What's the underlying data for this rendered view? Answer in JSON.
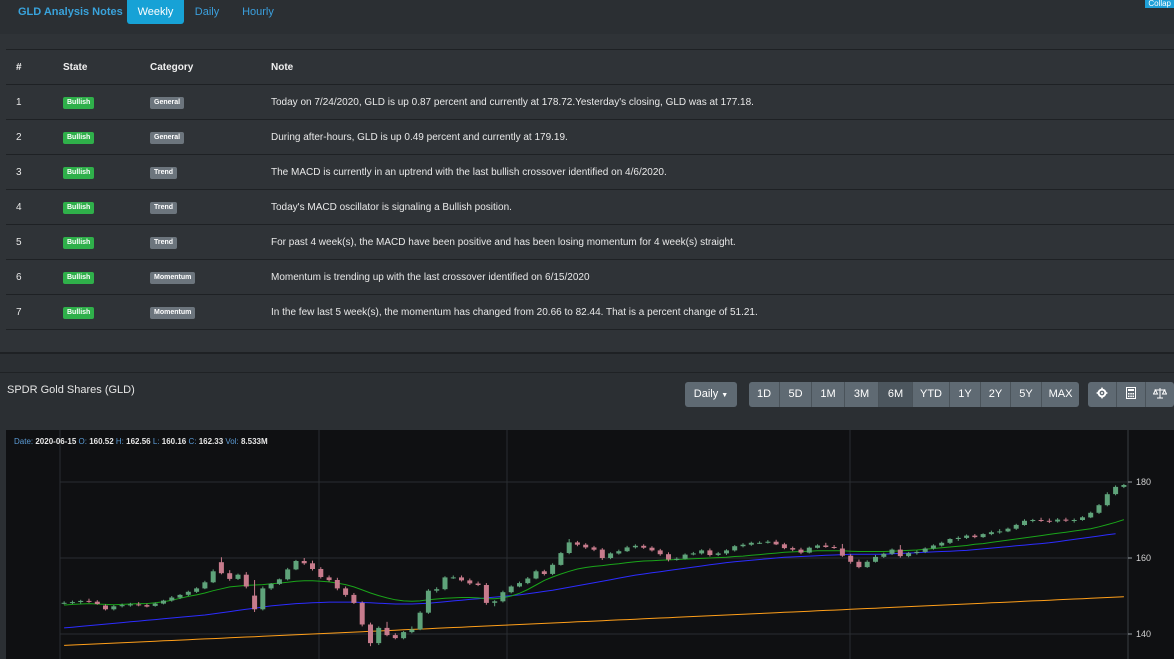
{
  "nav": {
    "brand": "GLD Analysis Notes",
    "tabs": [
      {
        "label": "Weekly",
        "active": true
      },
      {
        "label": "Daily",
        "active": false
      },
      {
        "label": "Hourly",
        "active": false
      }
    ],
    "collapse_label": "Collap"
  },
  "notes_table": {
    "headers": [
      "#",
      "State",
      "Category",
      "Note"
    ],
    "rows": [
      {
        "num": "1",
        "state": "Bullish",
        "category": "General",
        "note": "Today on 7/24/2020, GLD is up 0.87 percent and currently at 178.72.Yesterday's closing, GLD was at 177.18."
      },
      {
        "num": "2",
        "state": "Bullish",
        "category": "General",
        "note": "During after-hours, GLD is up 0.49 percent and currently at 179.19."
      },
      {
        "num": "3",
        "state": "Bullish",
        "category": "Trend",
        "note": "The MACD is currently in an uptrend with the last bullish crossover identified on 4/6/2020."
      },
      {
        "num": "4",
        "state": "Bullish",
        "category": "Trend",
        "note": "Today's MACD oscillator is signaling a Bullish position."
      },
      {
        "num": "5",
        "state": "Bullish",
        "category": "Trend",
        "note": "For past 4 week(s), the MACD have been positive and has been losing momentum for 4 week(s) straight."
      },
      {
        "num": "6",
        "state": "Bullish",
        "category": "Momentum",
        "note": "Momentum is trending up with the last crossover identified on 6/15/2020"
      },
      {
        "num": "7",
        "state": "Bullish",
        "category": "Momentum",
        "note": "In the few last 5 week(s), the momentum has changed from 20.66 to 82.44. That is a percent change of 51.21."
      }
    ]
  },
  "chart_header": {
    "title": "SPDR Gold Shares (GLD)",
    "interval_label": "Daily",
    "ranges": [
      "1D",
      "5D",
      "1M",
      "3M",
      "6M",
      "YTD",
      "1Y",
      "2Y",
      "5Y",
      "MAX"
    ],
    "active_range": "6M",
    "tool_icons": [
      "settings-icon",
      "calculator-icon",
      "balance-scale-icon"
    ]
  },
  "ohlc": {
    "date_label": "Date:",
    "date": "2020-06-15",
    "open_label": "O:",
    "open": "160.52",
    "high_label": "H:",
    "high": "162.56",
    "low_label": "L:",
    "low": "160.16",
    "close_label": "C:",
    "close": "162.33",
    "vol_label": "Vol:",
    "vol": "8.533M"
  },
  "colors": {
    "up": "#5fa37a",
    "down": "#c77b8c",
    "ma_short": "#1aa51a",
    "ma_mid": "#2c2cff",
    "ma_long": "#ff9f1a",
    "accent": "#17a2d6",
    "bullish": "#2fb04a"
  },
  "chart_data": {
    "type": "candlestick",
    "y_ticks": [
      "180",
      "160",
      "140"
    ],
    "ylim": [
      135,
      186
    ],
    "candles": [
      [
        148.1,
        148.6,
        147.8,
        148.2
      ],
      [
        148.2,
        148.8,
        147.9,
        148.4
      ],
      [
        148.4,
        149.0,
        148.0,
        148.7
      ],
      [
        148.7,
        149.3,
        148.2,
        148.5
      ],
      [
        148.5,
        148.9,
        147.7,
        147.9
      ],
      [
        147.5,
        147.8,
        146.2,
        146.5
      ],
      [
        146.5,
        147.6,
        146.2,
        147.3
      ],
      [
        147.3,
        148.0,
        147.0,
        147.6
      ],
      [
        147.6,
        148.2,
        147.2,
        147.8
      ],
      [
        147.8,
        148.4,
        147.3,
        147.6
      ],
      [
        147.6,
        148.0,
        147.0,
        147.2
      ],
      [
        147.4,
        148.3,
        147.2,
        148.0
      ],
      [
        148.0,
        149.0,
        147.8,
        148.8
      ],
      [
        148.8,
        150.0,
        148.5,
        149.6
      ],
      [
        149.6,
        150.5,
        149.2,
        150.3
      ],
      [
        150.3,
        151.4,
        150.0,
        151.1
      ],
      [
        151.1,
        152.3,
        150.8,
        152.0
      ],
      [
        152.0,
        154.0,
        151.8,
        153.6
      ],
      [
        153.6,
        157.0,
        153.4,
        156.5
      ],
      [
        158.9,
        160.2,
        155.7,
        156.0
      ],
      [
        156.0,
        156.8,
        154.0,
        154.5
      ],
      [
        154.5,
        155.9,
        154.2,
        155.6
      ],
      [
        155.6,
        156.3,
        152.0,
        152.5
      ],
      [
        150.1,
        154.2,
        145.8,
        146.5
      ],
      [
        146.5,
        152.5,
        146.2,
        152.0
      ],
      [
        152.0,
        153.4,
        151.6,
        153.2
      ],
      [
        153.2,
        154.6,
        152.9,
        154.4
      ],
      [
        154.4,
        157.4,
        154.1,
        157.0
      ],
      [
        157.0,
        159.5,
        156.8,
        159.2
      ],
      [
        159.2,
        160.0,
        158.2,
        158.6
      ],
      [
        158.6,
        159.3,
        156.7,
        157.1
      ],
      [
        157.1,
        157.6,
        154.6,
        155.0
      ],
      [
        154.9,
        155.4,
        153.8,
        154.2
      ],
      [
        154.2,
        154.8,
        151.5,
        152.0
      ],
      [
        152.0,
        152.5,
        149.8,
        150.3
      ],
      [
        150.3,
        150.8,
        147.9,
        148.2
      ],
      [
        148.2,
        148.6,
        142.0,
        142.5
      ],
      [
        142.5,
        143.0,
        136.8,
        137.6
      ],
      [
        137.6,
        142.0,
        137.1,
        141.6
      ],
      [
        141.6,
        143.2,
        139.4,
        139.7
      ],
      [
        139.7,
        140.2,
        138.6,
        138.9
      ],
      [
        138.9,
        140.8,
        138.6,
        140.5
      ],
      [
        140.5,
        142.0,
        140.2,
        141.2
      ],
      [
        141.2,
        146.0,
        141.0,
        145.6
      ],
      [
        145.6,
        151.8,
        145.3,
        151.4
      ],
      [
        151.4,
        152.3,
        150.9,
        151.8
      ],
      [
        151.8,
        155.2,
        151.5,
        154.9
      ],
      [
        154.9,
        155.4,
        154.5,
        154.9
      ],
      [
        154.9,
        155.4,
        153.8,
        154.1
      ],
      [
        154.1,
        154.6,
        152.9,
        153.3
      ],
      [
        153.3,
        153.8,
        152.6,
        152.9
      ],
      [
        152.9,
        153.4,
        147.7,
        148.2
      ],
      [
        148.2,
        148.9,
        147.3,
        148.6
      ],
      [
        148.6,
        151.4,
        148.3,
        151.0
      ],
      [
        151.0,
        152.8,
        150.7,
        152.5
      ],
      [
        152.5,
        153.8,
        152.3,
        153.4
      ],
      [
        153.4,
        155.0,
        153.1,
        154.6
      ],
      [
        154.6,
        156.9,
        154.4,
        156.5
      ],
      [
        156.5,
        156.9,
        155.4,
        155.8
      ],
      [
        155.8,
        158.6,
        155.5,
        158.2
      ],
      [
        158.2,
        161.6,
        158.0,
        161.3
      ],
      [
        161.3,
        165.0,
        161.0,
        164.1
      ],
      [
        164.1,
        164.5,
        163.1,
        163.5
      ],
      [
        163.5,
        163.9,
        162.4,
        162.8
      ],
      [
        162.8,
        163.2,
        161.8,
        162.2
      ],
      [
        162.2,
        162.6,
        159.5,
        160.0
      ],
      [
        160.0,
        161.5,
        159.7,
        161.2
      ],
      [
        161.2,
        162.2,
        160.9,
        161.8
      ],
      [
        161.8,
        163.2,
        161.6,
        162.8
      ],
      [
        162.8,
        163.6,
        162.5,
        163.2
      ],
      [
        163.2,
        163.6,
        162.4,
        162.7
      ],
      [
        162.7,
        163.1,
        161.7,
        162.0
      ],
      [
        162.0,
        162.4,
        160.6,
        161.0
      ],
      [
        161.0,
        161.5,
        159.1,
        159.6
      ],
      [
        159.6,
        160.2,
        159.3,
        159.8
      ],
      [
        159.8,
        161.2,
        159.6,
        160.9
      ],
      [
        160.9,
        161.6,
        160.7,
        161.2
      ],
      [
        161.2,
        162.3,
        160.9,
        162.0
      ],
      [
        162.0,
        162.5,
        160.4,
        160.8
      ],
      [
        160.8,
        161.6,
        160.5,
        161.2
      ],
      [
        161.2,
        162.3,
        160.8,
        162.0
      ],
      [
        162.0,
        163.4,
        161.7,
        163.1
      ],
      [
        163.1,
        163.9,
        162.8,
        163.5
      ],
      [
        163.5,
        164.3,
        163.2,
        164.0
      ],
      [
        164.0,
        164.4,
        163.7,
        164.0
      ],
      [
        164.0,
        164.7,
        163.8,
        164.3
      ],
      [
        164.3,
        164.8,
        163.4,
        163.6
      ],
      [
        163.6,
        164.0,
        162.3,
        162.6
      ],
      [
        162.6,
        163.0,
        161.8,
        162.2
      ],
      [
        162.2,
        162.7,
        161.0,
        161.4
      ],
      [
        161.4,
        163.0,
        161.2,
        162.7
      ],
      [
        162.7,
        163.6,
        162.5,
        163.3
      ],
      [
        163.3,
        164.0,
        162.7,
        162.9
      ],
      [
        162.9,
        163.4,
        162.4,
        162.8
      ],
      [
        162.5,
        163.7,
        160.3,
        160.6
      ],
      [
        160.6,
        161.0,
        158.5,
        159.0
      ],
      [
        159.0,
        159.6,
        157.3,
        157.6
      ],
      [
        157.6,
        159.4,
        157.4,
        159.0
      ],
      [
        159.0,
        160.8,
        158.8,
        160.3
      ],
      [
        160.3,
        161.4,
        160.0,
        161.1
      ],
      [
        161.1,
        162.5,
        160.8,
        162.2
      ],
      [
        162.2,
        163.4,
        160.1,
        160.5
      ],
      [
        160.5,
        161.6,
        160.2,
        161.3
      ],
      [
        161.3,
        162.0,
        160.9,
        161.6
      ],
      [
        161.6,
        162.8,
        161.3,
        162.5
      ],
      [
        162.5,
        163.6,
        162.2,
        163.3
      ],
      [
        163.3,
        164.3,
        163.0,
        164.0
      ],
      [
        164.0,
        165.2,
        163.7,
        165.0
      ],
      [
        165.0,
        165.7,
        164.5,
        165.3
      ],
      [
        165.3,
        166.2,
        165.0,
        165.9
      ],
      [
        165.9,
        166.3,
        165.2,
        165.5
      ],
      [
        165.5,
        166.5,
        165.3,
        166.3
      ],
      [
        166.3,
        167.2,
        166.0,
        166.8
      ],
      [
        166.8,
        167.6,
        166.4,
        167.0
      ],
      [
        167.0,
        168.0,
        166.8,
        167.7
      ],
      [
        167.7,
        169.0,
        167.4,
        168.7
      ],
      [
        168.7,
        170.2,
        168.5,
        169.8
      ],
      [
        169.8,
        170.3,
        169.4,
        170.0
      ],
      [
        170.0,
        170.6,
        169.5,
        169.8
      ],
      [
        169.8,
        170.4,
        169.2,
        169.6
      ],
      [
        169.6,
        170.5,
        169.3,
        170.1
      ],
      [
        170.1,
        170.6,
        169.5,
        169.8
      ],
      [
        169.8,
        170.4,
        169.3,
        170.0
      ],
      [
        170.0,
        171.0,
        169.8,
        170.7
      ],
      [
        170.7,
        172.2,
        170.5,
        171.9
      ],
      [
        171.9,
        174.2,
        171.6,
        173.9
      ],
      [
        173.9,
        177.3,
        173.6,
        176.8
      ],
      [
        176.8,
        179.1,
        176.5,
        178.7
      ],
      [
        178.7,
        179.5,
        178.4,
        179.2
      ]
    ],
    "sma20": [
      147.6,
      147.8,
      147.9,
      148.0,
      147.9,
      147.8,
      147.7,
      147.8,
      147.9,
      148.0,
      148.0,
      148.2,
      148.5,
      148.9,
      149.4,
      149.9,
      150.3,
      150.8,
      151.4,
      151.9,
      152.4,
      152.6,
      152.8,
      152.9,
      153.0,
      153.2,
      153.4,
      153.6,
      153.9,
      154.0,
      154.0,
      153.9,
      153.7,
      153.4,
      153.0,
      152.4,
      151.6,
      150.8,
      150.1,
      149.5,
      149.0,
      148.7,
      148.6,
      148.7,
      149.0,
      149.2,
      149.4,
      149.5,
      149.6,
      149.6,
      149.5,
      149.3,
      149.3,
      149.5,
      150.0,
      150.7,
      151.7,
      152.9,
      154.1,
      155.0,
      155.8,
      156.5,
      157.1,
      157.5,
      157.8,
      158.0,
      158.3,
      158.5,
      158.8,
      159.0,
      159.2,
      159.3,
      159.4,
      159.5,
      159.6,
      159.7,
      159.8,
      159.9,
      160.0,
      160.1,
      160.2,
      160.4,
      160.5,
      160.7,
      160.9,
      161.1,
      161.3,
      161.5,
      161.6,
      161.7,
      161.8,
      161.9,
      161.9,
      161.9,
      161.9,
      161.8,
      161.7,
      161.7,
      161.7,
      161.7,
      161.8,
      161.9,
      162.0,
      162.1,
      162.3,
      162.5,
      162.7,
      162.9,
      163.1,
      163.3,
      163.6,
      163.8,
      164.1,
      164.4,
      164.7,
      165.0,
      165.3,
      165.6,
      165.9,
      166.2,
      166.5,
      166.8,
      167.1,
      167.4,
      167.7,
      168.2,
      168.8,
      169.4,
      170.1
    ],
    "sma50": [
      141.6,
      141.8,
      142.0,
      142.2,
      142.4,
      142.6,
      142.8,
      143.0,
      143.2,
      143.4,
      143.6,
      143.8,
      144.0,
      144.2,
      144.4,
      144.6,
      144.8,
      145.0,
      145.3,
      145.6,
      145.9,
      146.2,
      146.5,
      146.8,
      147.1,
      147.4,
      147.6,
      147.8,
      148.0,
      148.1,
      148.2,
      148.3,
      148.4,
      148.4,
      148.4,
      148.4,
      148.3,
      148.2,
      148.1,
      148.0,
      147.9,
      147.9,
      147.9,
      148.0,
      148.1,
      148.3,
      148.5,
      148.7,
      148.9,
      149.1,
      149.3,
      149.5,
      149.7,
      149.9,
      150.1,
      150.3,
      150.6,
      150.9,
      151.2,
      151.5,
      151.9,
      152.3,
      152.7,
      153.1,
      153.5,
      153.9,
      154.3,
      154.7,
      155.1,
      155.5,
      155.8,
      156.1,
      156.4,
      156.7,
      157.0,
      157.3,
      157.6,
      157.9,
      158.2,
      158.5,
      158.8,
      159.0,
      159.2,
      159.4,
      159.6,
      159.8,
      160.0,
      160.2,
      160.3,
      160.4,
      160.5,
      160.6,
      160.7,
      160.8,
      160.9,
      161.0,
      161.0,
      161.0,
      161.0,
      161.0,
      161.1,
      161.2,
      161.3,
      161.4,
      161.5,
      161.6,
      161.7,
      161.8,
      161.9,
      162.0,
      162.2,
      162.4,
      162.6,
      162.8,
      163.0,
      163.2,
      163.4,
      163.6,
      163.8,
      164.0,
      164.3,
      164.6,
      164.9,
      165.2,
      165.5,
      165.8,
      166.1,
      166.4
    ],
    "sma200": [
      137.0,
      137.1,
      137.2,
      137.3,
      137.4,
      137.5,
      137.6,
      137.7,
      137.8,
      137.9,
      138.0,
      138.1,
      138.2,
      138.3,
      138.4,
      138.5,
      138.6,
      138.7,
      138.8,
      138.9,
      139.0,
      139.1,
      139.2,
      139.3,
      139.4,
      139.5,
      139.6,
      139.7,
      139.8,
      139.9,
      140.0,
      140.1,
      140.2,
      140.3,
      140.4,
      140.5,
      140.6,
      140.7,
      140.8,
      140.9,
      141.0,
      141.1,
      141.2,
      141.3,
      141.4,
      141.5,
      141.6,
      141.7,
      141.8,
      141.9,
      142.0,
      142.1,
      142.2,
      142.3,
      142.4,
      142.5,
      142.6,
      142.7,
      142.8,
      142.9,
      143.0,
      143.1,
      143.2,
      143.3,
      143.4,
      143.5,
      143.6,
      143.7,
      143.8,
      143.9,
      144.0,
      144.1,
      144.2,
      144.3,
      144.4,
      144.5,
      144.6,
      144.7,
      144.8,
      144.9,
      145.0,
      145.1,
      145.2,
      145.3,
      145.4,
      145.5,
      145.6,
      145.7,
      145.8,
      145.9,
      146.0,
      146.1,
      146.2,
      146.3,
      146.4,
      146.5,
      146.6,
      146.7,
      146.8,
      146.9,
      147.0,
      147.1,
      147.2,
      147.3,
      147.4,
      147.5,
      147.6,
      147.7,
      147.8,
      147.9,
      148.0,
      148.1,
      148.2,
      148.3,
      148.4,
      148.5,
      148.6,
      148.7,
      148.8,
      148.9,
      149.0,
      149.1,
      149.2,
      149.3,
      149.4,
      149.5,
      149.6,
      149.7,
      149.8
    ]
  }
}
